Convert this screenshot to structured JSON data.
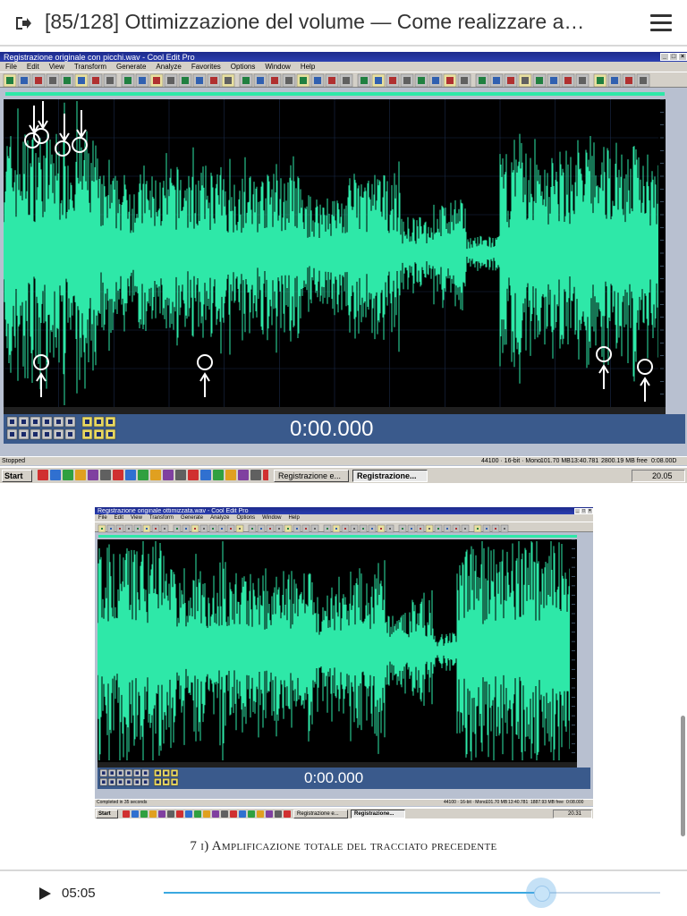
{
  "reader": {
    "title": "[85/128] Ottimizzazione del volume — Come realizzare a…",
    "caption": "7 i) Amplificazione totale del tracciato precedente",
    "elapsed": "05:05",
    "progress": 0.76
  },
  "colors": {
    "wave": "#2ee8a8",
    "wave_dark": "#22c090",
    "accent": "#3aa8e0"
  },
  "icons": {
    "exit": "exit-icon",
    "menu": "hamburger-menu-icon",
    "play": "play-icon"
  },
  "screen1": {
    "window_title": "Registrazione originale con picchi.wav - Cool Edit Pro",
    "menu": [
      "File",
      "Edit",
      "View",
      "Transform",
      "Generate",
      "Analyze",
      "Favorites",
      "Options",
      "Window",
      "Help"
    ],
    "time": "0:00.000",
    "status_left": "Stopped",
    "status_right": [
      "44100 · 16-bit · Mono",
      "101.70 MB",
      "13:40.781",
      "2800.19 MB free",
      "0:08.00D"
    ],
    "start": "Start",
    "tasks": [
      "Registrazione e...",
      "Registrazione..."
    ],
    "clock": "20.05",
    "peak_markers": 8
  },
  "screen2": {
    "window_title": "Registrazione originale ottimizzata.wav - Cool Edit Pro",
    "menu": [
      "File",
      "Edit",
      "View",
      "Transform",
      "Generate",
      "Analyze",
      "Options",
      "Window",
      "Help"
    ],
    "time": "0:00.000",
    "status_left": "Completed in 35 seconds",
    "status_right": [
      "44100 · 16-bit · Mono",
      "101.70 MB",
      "13:40.781",
      "1887.93 MB free",
      "0:08.000"
    ],
    "start": "Start",
    "tasks": [
      "Registrazione e...",
      "Registrazione..."
    ],
    "clock": "20.31"
  }
}
